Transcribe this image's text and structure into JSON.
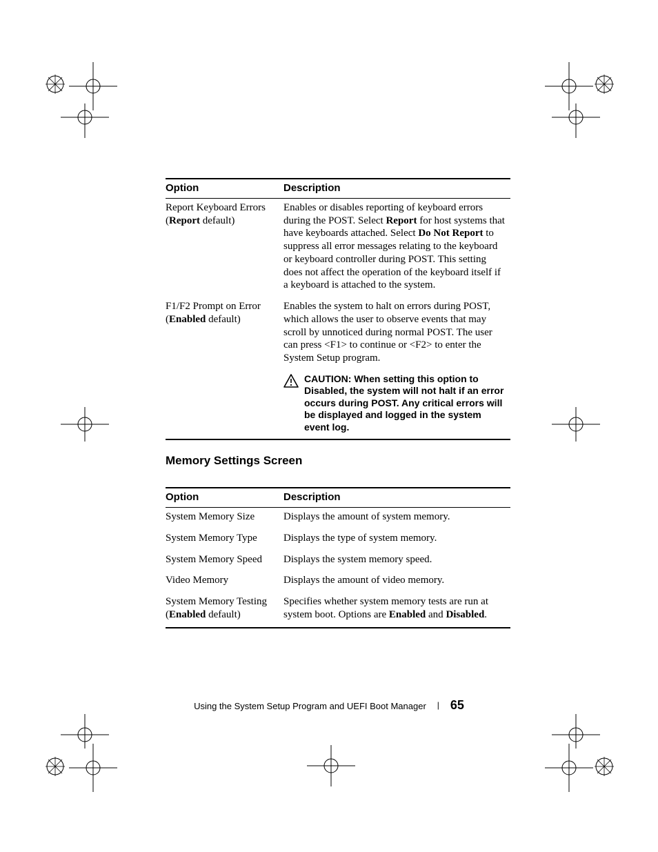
{
  "table1": {
    "headers": {
      "option": "Option",
      "description": "Description"
    },
    "rows": [
      {
        "option_html": "Report Keyboard Errors<br>(<b>Report</b> default)",
        "desc_html": "Enables or disables reporting of keyboard errors during the POST. Select <b>Report</b> for host systems that have keyboards attached. Select <b>Do Not Report</b> to suppress all error messages relating to the keyboard or keyboard controller during POST. This setting does not affect the operation of the keyboard itself if a keyboard is attached to the system."
      },
      {
        "option_html": "F1/F2 Prompt on Error<br>(<b>Enabled</b> default)",
        "desc_html": "Enables the system to halt on errors during POST, which allows the user to observe events that may scroll by unnoticed during normal POST. The user can press &lt;F1&gt; to continue or &lt;F2&gt; to enter the System Setup program."
      }
    ],
    "caution_html": "<span>CAUTION: When setting this option to Disabled, the system will not halt if an error occurs during POST. Any critical errors will be displayed and logged in the system event log.</span>"
  },
  "section_heading": "Memory Settings Screen",
  "table2": {
    "headers": {
      "option": "Option",
      "description": "Description"
    },
    "rows": [
      {
        "option_html": "System Memory Size",
        "desc_html": "Displays the amount of system memory."
      },
      {
        "option_html": "System Memory Type",
        "desc_html": "Displays the type of system memory."
      },
      {
        "option_html": "System Memory Speed",
        "desc_html": "Displays the system memory speed."
      },
      {
        "option_html": "Video Memory",
        "desc_html": "Displays the amount of video memory."
      },
      {
        "option_html": "System Memory Testing<br>(<b>Enabled</b> default)",
        "desc_html": "Specifies whether system memory tests are run at system boot. Options are <b>Enabled</b> and <b>Disabled</b>."
      }
    ]
  },
  "footer": {
    "label": "Using the System Setup Program and UEFI Boot Manager",
    "page": "65"
  }
}
